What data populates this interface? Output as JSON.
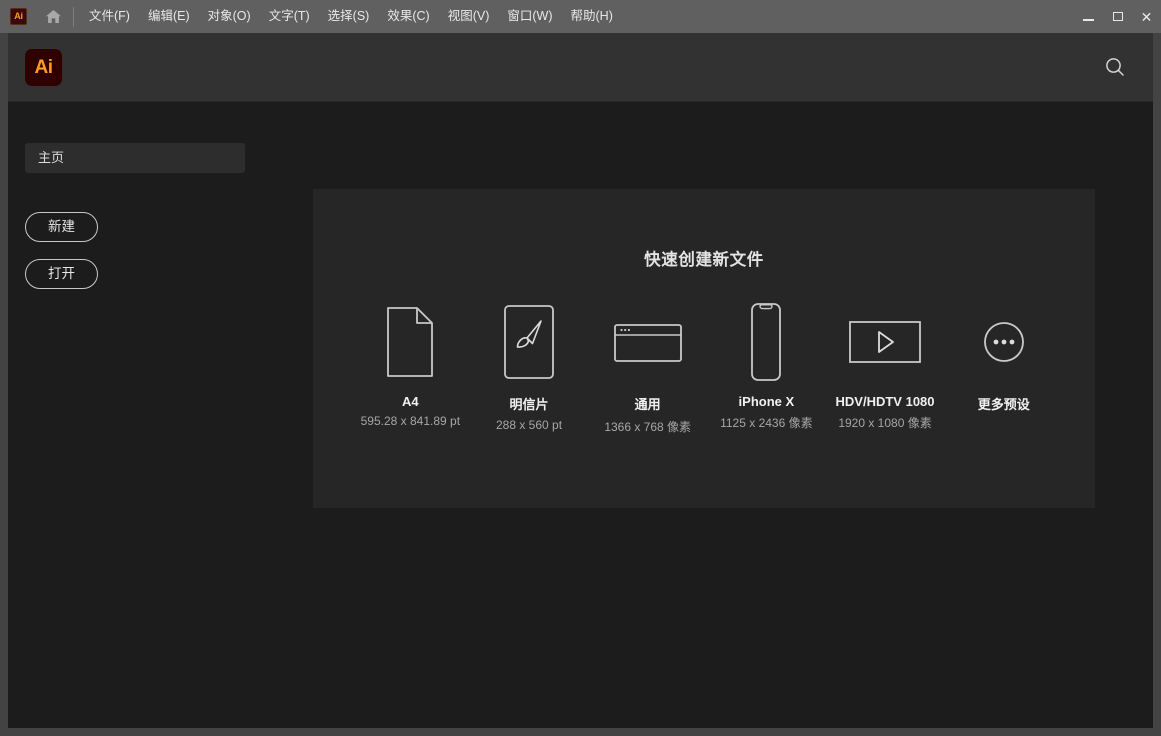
{
  "titlebar": {
    "app_icon": "illustrator-ai-icon",
    "home_icon": "home-icon",
    "menus": [
      {
        "label": "文件(F)",
        "name": "menu-file"
      },
      {
        "label": "编辑(E)",
        "name": "menu-edit"
      },
      {
        "label": "对象(O)",
        "name": "menu-object"
      },
      {
        "label": "文字(T)",
        "name": "menu-type"
      },
      {
        "label": "选择(S)",
        "name": "menu-select"
      },
      {
        "label": "效果(C)",
        "name": "menu-effect"
      },
      {
        "label": "视图(V)",
        "name": "menu-view"
      },
      {
        "label": "窗口(W)",
        "name": "menu-window"
      },
      {
        "label": "帮助(H)",
        "name": "menu-help"
      }
    ],
    "window_controls": {
      "minimize": "minimize-icon",
      "maximize": "maximize-icon",
      "close": "✕"
    }
  },
  "header": {
    "logo_text": "Ai",
    "logo_bg": "#2e0000",
    "logo_fg": "#ff9a1f",
    "search_icon": "search-icon"
  },
  "sidebar": {
    "nav": [
      {
        "label": "主页",
        "name": "sidebar-item-home",
        "selected": true
      }
    ],
    "buttons": [
      {
        "label": "新建",
        "name": "new-button"
      },
      {
        "label": "打开",
        "name": "open-button"
      }
    ]
  },
  "main": {
    "panel_title": "快速创建新文件",
    "presets": [
      {
        "label": "A4",
        "dims": "595.28 x 841.89 pt",
        "icon": "document-page-icon"
      },
      {
        "label": "明信片",
        "dims": "288 x 560 pt",
        "icon": "paintbrush-icon"
      },
      {
        "label": "通用",
        "dims": "1366 x 768 像素",
        "icon": "browser-window-icon"
      },
      {
        "label": "iPhone X",
        "dims": "1125 x 2436 像素",
        "icon": "mobile-phone-icon"
      },
      {
        "label": "HDV/HDTV 1080",
        "dims": "1920 x 1080 像素",
        "icon": "video-play-icon"
      },
      {
        "label": "更多预设",
        "dims": "",
        "icon": "ellipsis-circle-icon"
      }
    ]
  },
  "colors": {
    "titlebar_bg": "#606060",
    "header_bg": "#323232",
    "body_bg": "#1c1c1c",
    "panel_bg": "#262626",
    "accent_orange": "#ff9a1f",
    "stroke": "#c8c8c8"
  }
}
